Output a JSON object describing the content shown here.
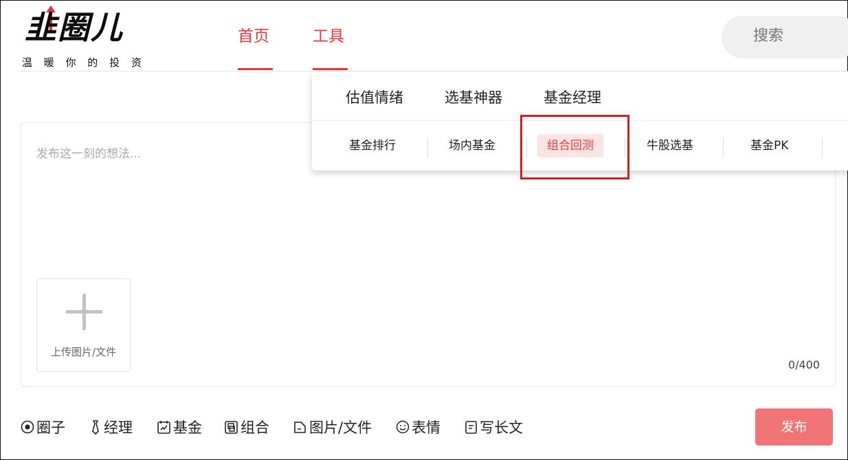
{
  "logo": {
    "text": "韭圈儿",
    "slogan": "温 暖 你 的 投 资"
  },
  "nav": {
    "tabs": [
      {
        "label": "首页"
      },
      {
        "label": "工具"
      }
    ]
  },
  "search": {
    "placeholder": "搜索"
  },
  "dropdown": {
    "top_tabs": [
      "估值情绪",
      "选基神器",
      "基金经理"
    ],
    "items": [
      "基金排行",
      "场内基金",
      "组合回测",
      "牛股选基",
      "基金PK"
    ],
    "active_item": "组合回测"
  },
  "editor": {
    "placeholder": "发布这一刻的想法...",
    "upload_label": "上传图片/文件",
    "counter": "0/400"
  },
  "toolbar": {
    "items": [
      "圈子",
      "经理",
      "基金",
      "组合",
      "图片/文件",
      "表情",
      "写长文"
    ],
    "publish_label": "发布"
  },
  "colors": {
    "accent": "#e4393c",
    "publish_button": "#f17477",
    "active_item_bg": "#fde4e4",
    "highlight_box": "#d61c20"
  }
}
